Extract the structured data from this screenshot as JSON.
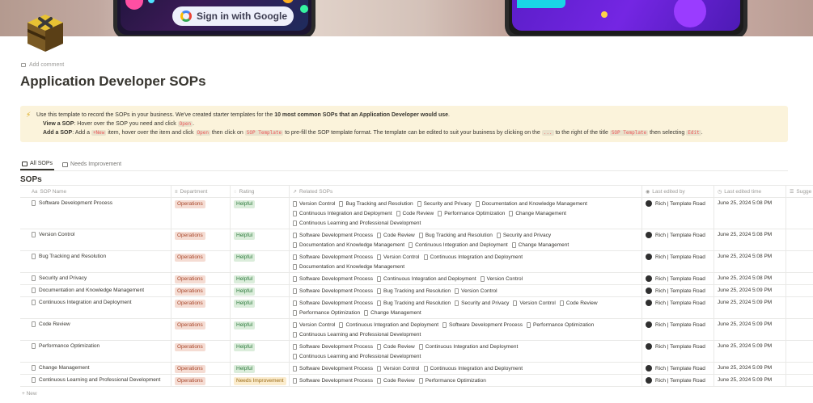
{
  "cover": {
    "button_label": "Sign in with Google"
  },
  "add_comment": "Add comment",
  "title": "Application Developer SOPs",
  "callout": {
    "line1_a": "Use this template to record the SOPs in your business. We've created starter templates for the ",
    "line1_b": "10 most common SOPs that an Application Developer would use",
    "line1_c": ".",
    "line2_label": "View a SOP",
    "line2_text": ": Hover over the SOP you need and click ",
    "line2_code": "Open",
    "line2_end": ".",
    "line3_label": "Add a SOP",
    "line3_a": ": Add a ",
    "line3_code1": "+New",
    "line3_b": " item, hover over the item and click ",
    "line3_code2": "Open",
    "line3_c": " then click on ",
    "line3_code3": "SOP Template",
    "line3_d": " to pre-fill the SOP template format. The template can be edited to suit your business by clicking on the ",
    "line3_code4": "...",
    "line3_e": " to the right of the title ",
    "line3_code5": "SOP Template",
    "line3_f": " then selecting ",
    "line3_code6": "Edit",
    "line3_g": "."
  },
  "tabs": [
    {
      "label": "All SOPs"
    },
    {
      "label": "Needs Improvement"
    }
  ],
  "database_title": "SOPs",
  "columns": {
    "name": "SOP Name",
    "department": "Department",
    "rating": "Rating",
    "related": "Related SOPs",
    "edited_by": "Last edited by",
    "edited_time": "Last edited time",
    "suggest": "Sugge"
  },
  "rows": [
    {
      "name": "Software Development Process",
      "department": "Operations",
      "rating": "Helpful",
      "related": [
        "Version Control",
        "Bug Tracking and Resolution",
        "Security and Privacy",
        "Documentation and Knowledge Management",
        "Continuous Integration and Deployment",
        "Code Review",
        "Performance Optimization",
        "Change Management",
        "Continuous Learning and Professional Development"
      ],
      "edited_by": "Rich | Template Road",
      "edited_time": "June 25, 2024 5:08 PM"
    },
    {
      "name": "Version Control",
      "department": "Operations",
      "rating": "Helpful",
      "related": [
        "Software Development Process",
        "Code Review",
        "Bug Tracking and Resolution",
        "Security and Privacy",
        "Documentation and Knowledge Management",
        "Continuous Integration and Deployment",
        "Change Management"
      ],
      "edited_by": "Rich | Template Road",
      "edited_time": "June 25, 2024 5:08 PM"
    },
    {
      "name": "Bug Tracking and Resolution",
      "department": "Operations",
      "rating": "Helpful",
      "related": [
        "Software Development Process",
        "Version Control",
        "Continuous Integration and Deployment",
        "Documentation and Knowledge Management"
      ],
      "edited_by": "Rich | Template Road",
      "edited_time": "June 25, 2024 5:08 PM"
    },
    {
      "name": "Security and Privacy",
      "department": "Operations",
      "rating": "Helpful",
      "related": [
        "Software Development Process",
        "Continuous Integration and Deployment",
        "Version Control"
      ],
      "edited_by": "Rich | Template Road",
      "edited_time": "June 25, 2024 5:08 PM"
    },
    {
      "name": "Documentation and Knowledge Management",
      "department": "Operations",
      "rating": "Helpful",
      "related": [
        "Software Development Process",
        "Bug Tracking and Resolution",
        "Version Control"
      ],
      "edited_by": "Rich | Template Road",
      "edited_time": "June 25, 2024 5:09 PM"
    },
    {
      "name": "Continuous Integration and Deployment",
      "department": "Operations",
      "rating": "Helpful",
      "related": [
        "Software Development Process",
        "Bug Tracking and Resolution",
        "Security and Privacy",
        "Version Control",
        "Code Review",
        "Performance Optimization",
        "Change Management"
      ],
      "edited_by": "Rich | Template Road",
      "edited_time": "June 25, 2024 5:09 PM"
    },
    {
      "name": "Code Review",
      "department": "Operations",
      "rating": "Helpful",
      "related": [
        "Version Control",
        "Continuous Integration and Deployment",
        "Software Development Process",
        "Performance Optimization",
        "Continuous Learning and Professional Development"
      ],
      "edited_by": "Rich | Template Road",
      "edited_time": "June 25, 2024 5:09 PM"
    },
    {
      "name": "Performance Optimization",
      "department": "Operations",
      "rating": "Helpful",
      "related": [
        "Software Development Process",
        "Code Review",
        "Continuous Integration and Deployment",
        "Continuous Learning and Professional Development"
      ],
      "edited_by": "Rich | Template Road",
      "edited_time": "June 25, 2024 5:09 PM"
    },
    {
      "name": "Change Management",
      "department": "Operations",
      "rating": "Helpful",
      "related": [
        "Software Development Process",
        "Version Control",
        "Continuous Integration and Deployment"
      ],
      "edited_by": "Rich | Template Road",
      "edited_time": "June 25, 2024 5:09 PM"
    },
    {
      "name": "Continuous Learning and Professional Development",
      "department": "Operations",
      "rating": "Needs Improvement",
      "related": [
        "Software Development Process",
        "Code Review",
        "Performance Optimization"
      ],
      "edited_by": "Rich | Template Road",
      "edited_time": "June 25, 2024 5:09 PM"
    }
  ],
  "new_row": "+ New"
}
